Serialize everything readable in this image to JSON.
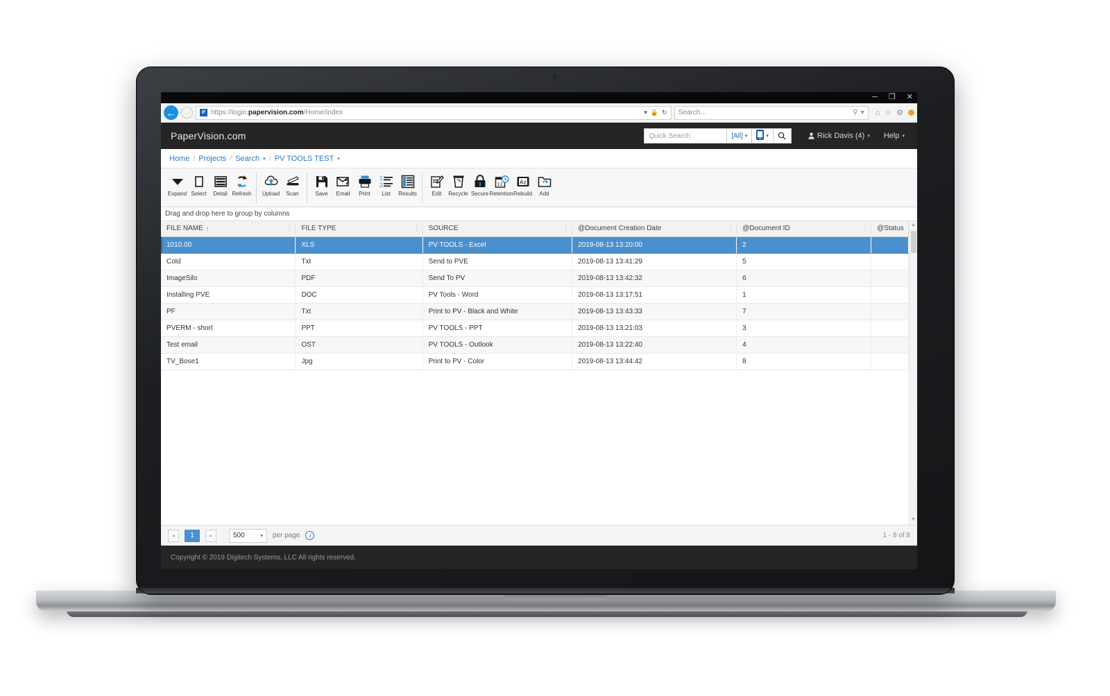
{
  "browser": {
    "url_scheme": "https://login.",
    "url_host": "papervision.com",
    "url_path": "/Home/Index",
    "search_placeholder": "Search...",
    "minimize_label": "─",
    "maximize_label": "❐",
    "close_label": "✕",
    "back_label": "←",
    "forward_label": "→",
    "favicon_text": "P",
    "lock_icon": "🔒",
    "refresh_icon": "↻",
    "dropdown_caret": "▾",
    "search_caret": "▾",
    "search_glyph": "⚲",
    "home_icon": "⌂",
    "fav_icon": "☆",
    "gear_icon": "⚙"
  },
  "header": {
    "brand": "PaperVision.com",
    "quick_search_placeholder": "Quick Search",
    "scope_label": "[All]",
    "search_button_icon": "⚲",
    "device_icon": "▢",
    "user": "Rick Davis (4)",
    "help": "Help",
    "caret": "▾"
  },
  "breadcrumb": {
    "items": [
      {
        "label": "Home",
        "caret": false
      },
      {
        "label": "Projects",
        "caret": false
      },
      {
        "label": "Search",
        "caret": true
      },
      {
        "label": "PV TOOLS TEST",
        "caret": true
      }
    ],
    "separator": "/"
  },
  "toolbar": {
    "groups": [
      {
        "items": [
          {
            "label": "Expand",
            "icon": "expand-caret-icon"
          },
          {
            "label": "Select",
            "icon": "select-square-icon"
          },
          {
            "label": "Detail",
            "icon": "detail-rows-icon"
          },
          {
            "label": "Refresh",
            "icon": "refresh-arrows-icon"
          }
        ]
      },
      {
        "items": [
          {
            "label": "Upload",
            "icon": "cloud-upload-icon"
          },
          {
            "label": "Scan",
            "icon": "scanner-icon"
          }
        ]
      },
      {
        "items": [
          {
            "label": "Save",
            "icon": "floppy-save-icon"
          },
          {
            "label": "Email",
            "icon": "email-attach-icon"
          },
          {
            "label": "Print",
            "icon": "printer-icon"
          },
          {
            "label": "List",
            "icon": "numbered-list-icon"
          },
          {
            "label": "Results",
            "icon": "results-grid-icon"
          }
        ]
      },
      {
        "items": [
          {
            "label": "Edit",
            "icon": "edit-pencil-icon"
          },
          {
            "label": "Recycle",
            "icon": "recycle-bin-icon"
          },
          {
            "label": "Secure",
            "icon": "lock-icon"
          },
          {
            "label": "Retention",
            "icon": "retention-clock-icon"
          },
          {
            "label": "Rebuild",
            "icon": "rebuild-az-icon"
          },
          {
            "label": "Add",
            "icon": "add-folder-icon"
          }
        ]
      }
    ]
  },
  "group_bar": {
    "text": "Drag and drop here to group by columns"
  },
  "grid": {
    "columns": [
      {
        "label": "FILE NAME",
        "sorted": "asc",
        "width": "18%"
      },
      {
        "label": "FILE TYPE",
        "sorted": "",
        "width": "17%"
      },
      {
        "label": "SOURCE",
        "sorted": "",
        "width": "20%"
      },
      {
        "label": "@Document Creation Date",
        "sorted": "",
        "width": "22%"
      },
      {
        "label": "@Document ID",
        "sorted": "",
        "width": "18%"
      },
      {
        "label": "@Status",
        "sorted": "",
        "width": "5%"
      }
    ],
    "sort_asc_glyph": "↑",
    "grip_glyph": "⋮",
    "rows": [
      {
        "selected": true,
        "cells": [
          "1010.00",
          "XLS",
          "PV TOOLS - Excel",
          "2019-08-13 13:20:00",
          "2",
          ""
        ]
      },
      {
        "selected": false,
        "cells": [
          "Cold",
          "Txt",
          "Send to PVE",
          "2019-08-13 13:41:29",
          "5",
          ""
        ]
      },
      {
        "selected": false,
        "cells": [
          "ImageSilo",
          "PDF",
          "Send To PV",
          "2019-08-13 13:42:32",
          "6",
          ""
        ]
      },
      {
        "selected": false,
        "cells": [
          "Installing PVE",
          "DOC",
          "PV Tools - Word",
          "2019-08-13 13:17:51",
          "1",
          ""
        ]
      },
      {
        "selected": false,
        "cells": [
          "PF",
          "Txt",
          "Print to PV - Black and White",
          "2019-08-13 13:43:33",
          "7",
          ""
        ]
      },
      {
        "selected": false,
        "cells": [
          "PVERM - short",
          "PPT",
          "PV TOOLS - PPT",
          "2019-08-13 13:21:03",
          "3",
          ""
        ]
      },
      {
        "selected": false,
        "cells": [
          "Test email",
          "OST",
          "PV TOOLS - Outlook",
          "2019-08-13 13:22:40",
          "4",
          ""
        ]
      },
      {
        "selected": false,
        "cells": [
          "TV_Bose1",
          "Jpg",
          "Print to PV - Color",
          "2019-08-13 13:44:42",
          "8",
          ""
        ]
      }
    ]
  },
  "pager": {
    "prev_icon": "◂",
    "next_icon": "▸",
    "current_page": "1",
    "page_size": "500",
    "page_size_caret": "▾",
    "per_page_label": "per page",
    "info_icon": "i",
    "range_label": "1 - 8 of 8"
  },
  "footer": {
    "copyright": "Copyright © 2019 Digitech Systems, LLC All rights reserved."
  },
  "scrollbar": {
    "up_icon": "▲",
    "down_icon": "▼"
  }
}
